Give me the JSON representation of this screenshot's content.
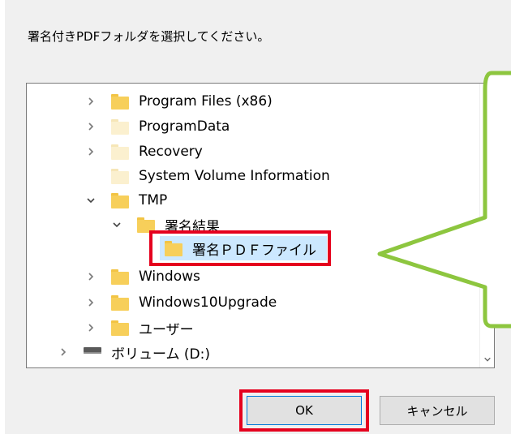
{
  "dialog": {
    "prompt": "署名付きPDFフォルダを選択してください。",
    "ok_label": "OK",
    "cancel_label": "キャンセル"
  },
  "tree": {
    "items": [
      {
        "label": "Program Files (x86)",
        "expander": "collapsed",
        "icon": "folder-icon"
      },
      {
        "label": "ProgramData",
        "expander": "collapsed",
        "icon": "folder-hidden-icon"
      },
      {
        "label": "Recovery",
        "expander": "collapsed",
        "icon": "folder-hidden-icon"
      },
      {
        "label": "System Volume Information",
        "expander": "none",
        "icon": "folder-hidden-icon"
      },
      {
        "label": "TMP",
        "expander": "expanded",
        "icon": "folder-icon"
      },
      {
        "label": "署名結果",
        "expander": "expanded",
        "icon": "folder-icon"
      },
      {
        "label": "署名ＰＤＦファイル",
        "expander": "none",
        "icon": "folder-icon",
        "selected": true
      },
      {
        "label": "Windows",
        "expander": "collapsed",
        "icon": "folder-icon"
      },
      {
        "label": "Windows10Upgrade",
        "expander": "collapsed",
        "icon": "folder-icon"
      },
      {
        "label": "ユーザー",
        "expander": "collapsed",
        "icon": "folder-icon"
      },
      {
        "label": "ボリューム (D:)",
        "expander": "collapsed",
        "icon": "drive-icon"
      }
    ]
  },
  "colors": {
    "highlight_red": "#e5001e",
    "callout_green": "#8dc63f",
    "selection_blue": "#cce8ff",
    "folder_yellow": "#f7cf5a"
  }
}
